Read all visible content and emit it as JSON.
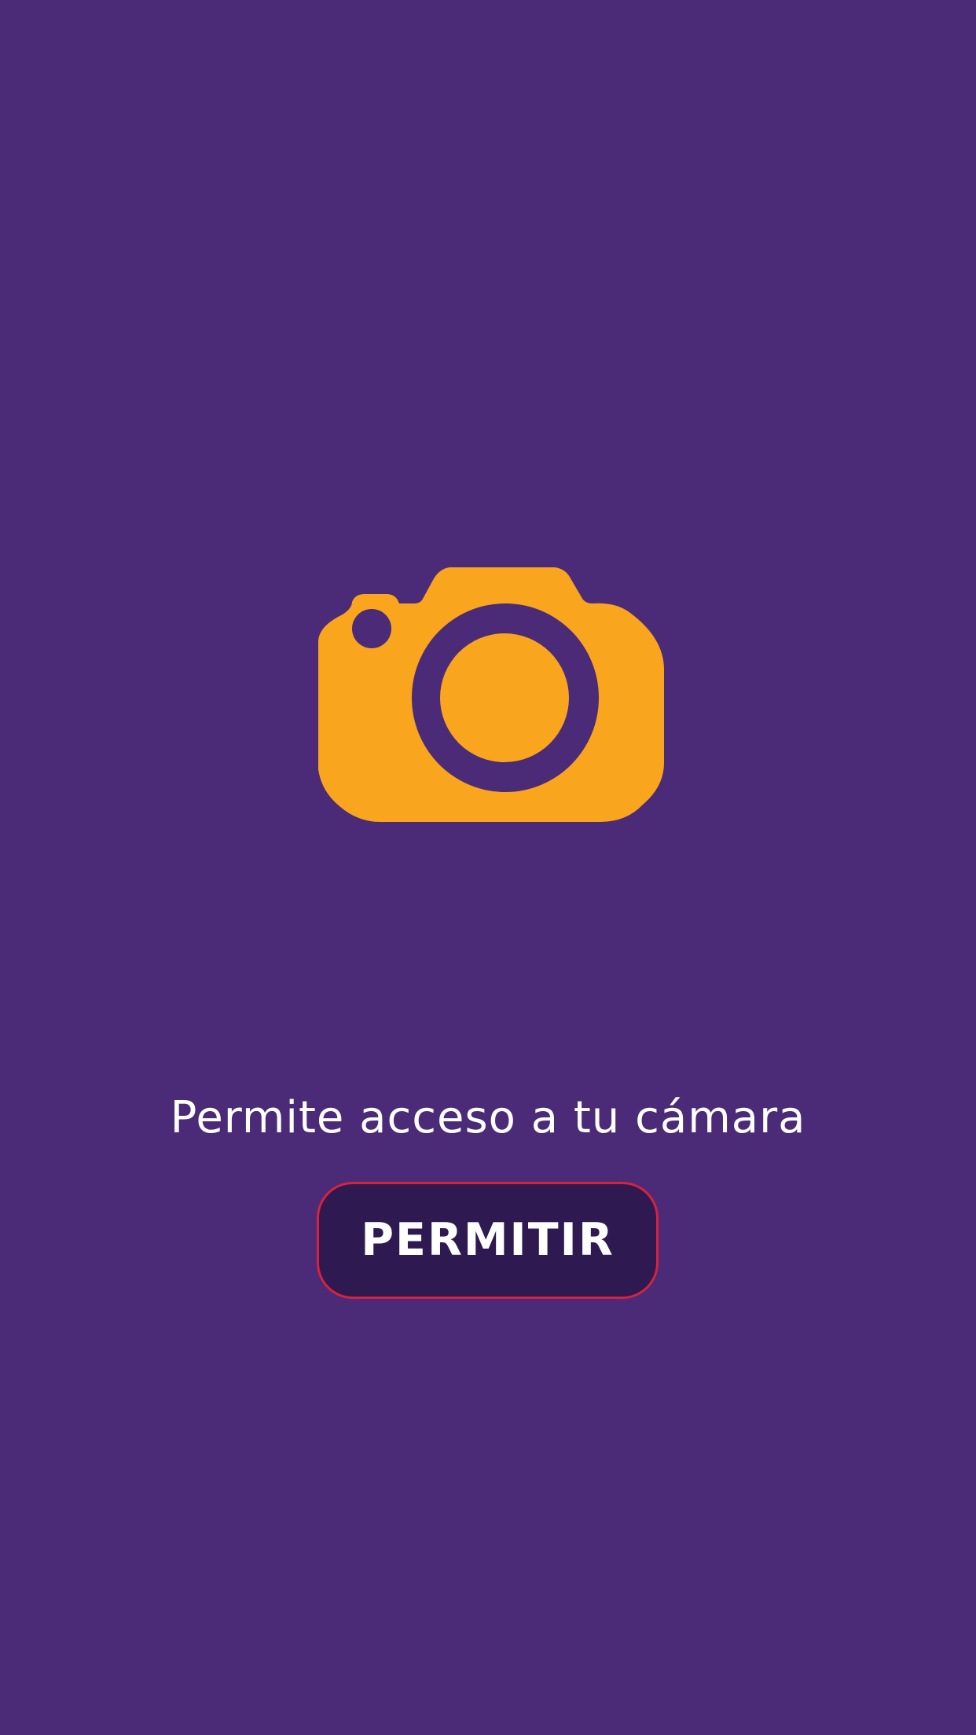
{
  "permission": {
    "message": "Permite acceso a tu cámara",
    "button_label": "PERMITIR"
  },
  "icon": {
    "name": "camera-icon"
  },
  "colors": {
    "background": "#4b2a77",
    "icon": "#f9a51e",
    "button_fill": "#2e1a50",
    "button_border": "#d6223e",
    "text": "#ffffff"
  }
}
